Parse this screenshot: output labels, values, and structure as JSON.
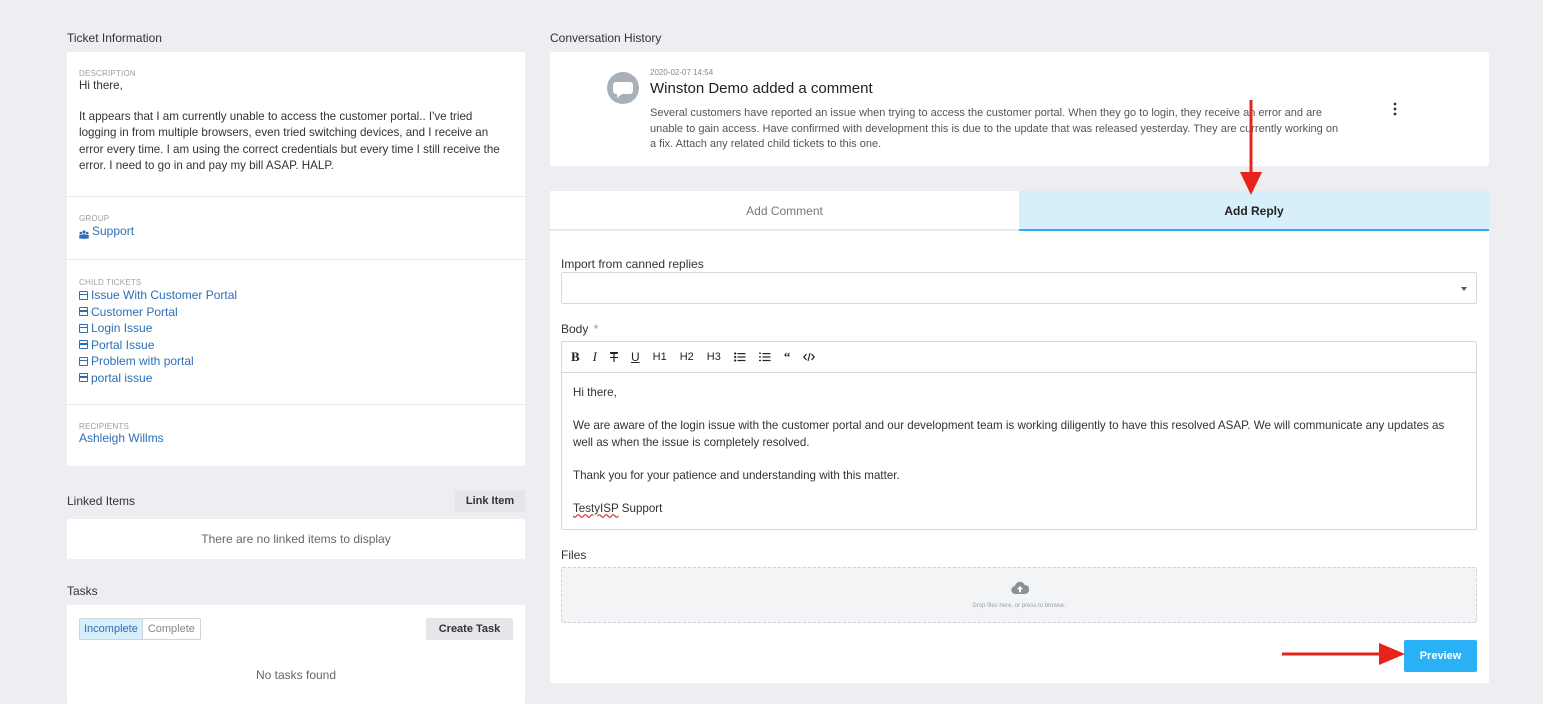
{
  "ticket_info": {
    "section_title": "Ticket Information",
    "description_label": "DESCRIPTION",
    "description_greeting": "Hi there,",
    "description_body": "It appears that I am currently unable to access the customer portal.. I've tried logging in from multiple browsers, even tried switching devices, and I receive an error every time. I am using the correct credentials but every time I still receive the error. I need to go in and pay my bill ASAP. HALP.",
    "group_label": "GROUP",
    "group_value": "Support",
    "child_tickets_label": "CHILD TICKETS",
    "child_tickets": [
      "Issue With Customer Portal",
      "Customer Portal",
      "Login Issue",
      "Portal Issue",
      "Problem with portal",
      "portal issue"
    ],
    "recipients_label": "RECIPIENTS",
    "recipient": "Ashleigh Willms"
  },
  "linked_items": {
    "title": "Linked Items",
    "button": "Link Item",
    "empty": "There are no linked items to display"
  },
  "tasks": {
    "title": "Tasks",
    "tab_incomplete": "Incomplete",
    "tab_complete": "Complete",
    "create_button": "Create Task",
    "empty": "No tasks found"
  },
  "conversation": {
    "section_title": "Conversation History",
    "timestamp": "2020-02-07 14:54",
    "author_line": "Winston Demo added a comment",
    "comment": "Several customers have reported an issue when trying to access the customer portal. When they go to login, they receive an error and are unable to gain access. Have confirmed with development this is due to the update that was released yesterday. They are currently working on a fix. Attach any related child tickets to this one."
  },
  "reply": {
    "tab_add_comment": "Add Comment",
    "tab_add_reply": "Add Reply",
    "canned_label": "Import from canned replies",
    "canned_value": "",
    "body_label": "Body",
    "required_mark": "*",
    "toolbar": [
      "B",
      "I",
      "T",
      "U",
      "H1",
      "H2",
      "H3",
      "bulleted-list-icon",
      "numbered-list-icon",
      "quote-icon",
      "code-icon"
    ],
    "body_p1": "Hi there,",
    "body_p2": "We are aware of the login issue with the customer portal and our development team is working diligently to have this resolved ASAP. We will communicate any updates as well as when the issue is completely resolved.",
    "body_p3": "Thank you for your patience and understanding with this matter.",
    "body_sig_underlined": "TestyISP",
    "body_sig_rest": " Support",
    "files_label": "Files",
    "dropzone_text": "Drop files here, or press to browse.",
    "preview_button": "Preview"
  },
  "colors": {
    "accent": "#2ab0f5",
    "active_tab_bg": "#d7effb",
    "link": "#2d6fb7",
    "annotation_arrow": "#e8231b"
  }
}
